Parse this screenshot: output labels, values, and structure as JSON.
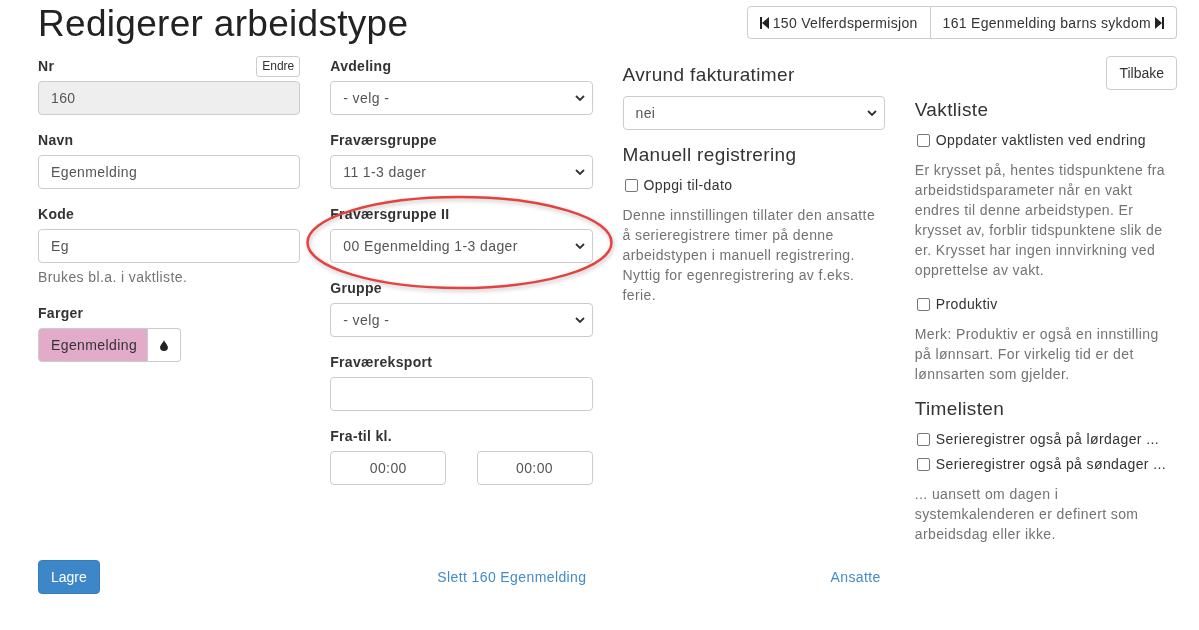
{
  "page": {
    "title": "Redigerer arbeidstype"
  },
  "record_navigation": [
    {
      "kind": "previous",
      "label": "150 Velferdspermisjon"
    },
    {
      "kind": "next",
      "label": "161 Egenmelding barns sykdom"
    }
  ],
  "columns": [
    {
      "items": [
        {
          "kind": "input",
          "label": "Nr",
          "value": "160",
          "disabled": true,
          "action": "Endre"
        },
        {
          "kind": "input",
          "label": "Navn",
          "value": "Egenmelding",
          "disabled": false
        },
        {
          "kind": "input",
          "label": "Kode",
          "value": "Eg",
          "disabled": false
        },
        {
          "kind": "help",
          "text": "Brukes bl.a. i vaktliste."
        },
        {
          "kind": "color",
          "label": "Farger",
          "value": "Egenmelding",
          "color": "#e1abc9"
        }
      ]
    },
    {
      "items": [
        {
          "kind": "select",
          "label": "Avdeling",
          "value": "- velg -",
          "highlighted": false
        },
        {
          "kind": "select",
          "label": "Fraværsgruppe",
          "value": "11 1-3 dager",
          "highlighted": false
        },
        {
          "kind": "select",
          "label": "Fraværsgruppe II",
          "value": "00 Egenmelding 1-3 dager",
          "highlighted": true
        },
        {
          "kind": "select",
          "label": "Gruppe",
          "value": "- velg -",
          "highlighted": false
        },
        {
          "kind": "input",
          "label": "Fraværeksport",
          "disabled": false
        },
        {
          "kind": "time_range",
          "label": "Fra-til kl.",
          "from": "00:00",
          "to": "00:00"
        }
      ]
    },
    {
      "items": [
        {
          "kind": "heading",
          "text": "Avrund fakturatimer"
        },
        {
          "kind": "select",
          "value": "nei",
          "highlighted": false
        },
        {
          "kind": "heading",
          "text": "Manuell registrering"
        },
        {
          "kind": "checkbox",
          "label": "Oppgi til-dato",
          "checked": false
        },
        {
          "kind": "help",
          "text": "Denne innstillingen tillater den ansatte å serieregistrere timer på denne arbeidstypen i manuell registrering. Nyttig for egenregistrering av f.eks. ferie."
        }
      ]
    },
    {
      "items": [
        {
          "kind": "button",
          "label": "Tilbake"
        },
        {
          "kind": "heading",
          "text": "Vaktliste"
        },
        {
          "kind": "checkbox",
          "label": "Oppdater vaktlisten ved endring",
          "checked": false
        },
        {
          "kind": "help",
          "text": "Er krysset på, hentes tidspunktene fra arbeidstidsparameter når en vakt endres til denne arbeidstypen. Er krysset av, forblir tidspunktene slik de er. Krysset har ingen innvirkning ved opprettelse av vakt."
        },
        {
          "kind": "checkbox",
          "label": "Produktiv",
          "checked": false
        },
        {
          "kind": "help",
          "text": "Merk: Produktiv er også en innstilling på lønnsart. For virkelig tid er det lønnsarten som gjelder."
        },
        {
          "kind": "heading",
          "text": "Timelisten"
        },
        {
          "kind": "checkbox",
          "label": "Serieregistrer også på lørdager ...",
          "checked": false
        },
        {
          "kind": "checkbox",
          "label": "Serieregistrer også på søndager ...",
          "checked": false
        },
        {
          "kind": "help",
          "text": "... uansett om dagen i systemkalenderen er definert som arbeidsdag eller ikke."
        }
      ]
    }
  ],
  "footer": {
    "save_button": "Lagre",
    "delete_link": "Slett 160 Egenmelding",
    "employees_link": "Ansatte"
  }
}
